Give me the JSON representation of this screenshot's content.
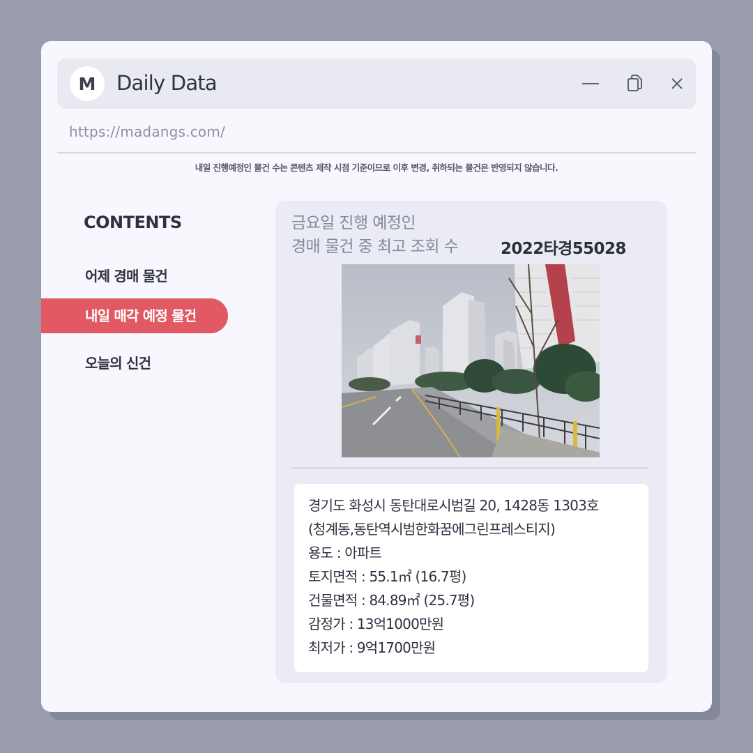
{
  "app": {
    "avatar_letter": "M",
    "title": "Daily Data",
    "url": "https://madangs.com/"
  },
  "notice": "내일 진행예정인 물건 수는 콘텐츠 제작 시점 기준이므로 이후 변경, 취하되는 물건은 반영되지 않습니다.",
  "sidebar": {
    "heading": "CONTENTS",
    "items": [
      {
        "label": "어제 경매 물건",
        "active": false
      },
      {
        "label": "내일 매각 예정 물건",
        "active": true
      },
      {
        "label": "오늘의 신건",
        "active": false
      }
    ]
  },
  "card": {
    "title_line1": "금요일 진행 예정인",
    "title_line2": "경매 물건 중 최고 조회 수",
    "case_number": "2022타경55028",
    "address_line1": "경기도 화성시 동탄대로시범길 20, 1428동 1303호",
    "address_line2": "(청계동,동탄역시범한화꿈에그린프레스티지)",
    "specs": [
      "용도 : 아파트",
      "토지면적 : 55.1㎡ (16.7평)",
      "건물면적 : 84.89㎡ (25.7평)",
      "감정가 : 13억1000만원",
      "최저가 : 9억1700만원"
    ]
  },
  "colors": {
    "accent": "#e15a63",
    "background": "#9a9cae",
    "window": "#f7f7fd"
  }
}
